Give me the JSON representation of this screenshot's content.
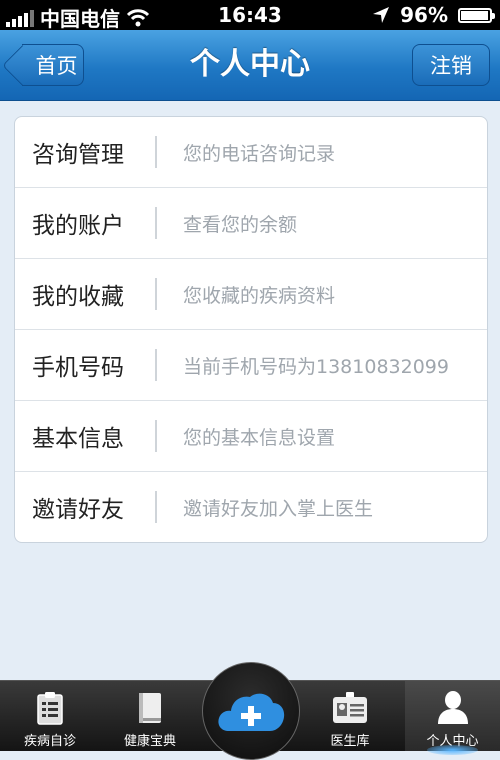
{
  "status_bar": {
    "carrier": "中国电信",
    "time": "16:43",
    "battery": "96%",
    "battery_level": 0.96
  },
  "nav": {
    "back_label": "首页",
    "title": "个人中心",
    "logout_label": "注销"
  },
  "menu": {
    "items": [
      {
        "label": "咨询管理",
        "desc": "您的电话咨询记录"
      },
      {
        "label": "我的账户",
        "desc": "查看您的余额"
      },
      {
        "label": "我的收藏",
        "desc": "您收藏的疾病资料"
      },
      {
        "label": "手机号码",
        "desc": "当前手机号码为13810832099"
      },
      {
        "label": "基本信息",
        "desc": "您的基本信息设置"
      },
      {
        "label": "邀请好友",
        "desc": "邀请好友加入掌上医生"
      }
    ]
  },
  "tab_bar": {
    "tabs": [
      {
        "label": "疾病自诊",
        "icon": "clipboard-icon"
      },
      {
        "label": "健康宝典",
        "icon": "book-icon"
      },
      {
        "label": "医生库",
        "icon": "id-card-icon"
      },
      {
        "label": "个人中心",
        "icon": "person-icon",
        "active": true
      }
    ],
    "center_icon": "cloud-plus-icon"
  },
  "colors": {
    "nav_blue": "#1f78c4",
    "background": "#e4edf6",
    "desc_gray": "#9fa6ad",
    "accent_glow": "#57b5ff"
  }
}
